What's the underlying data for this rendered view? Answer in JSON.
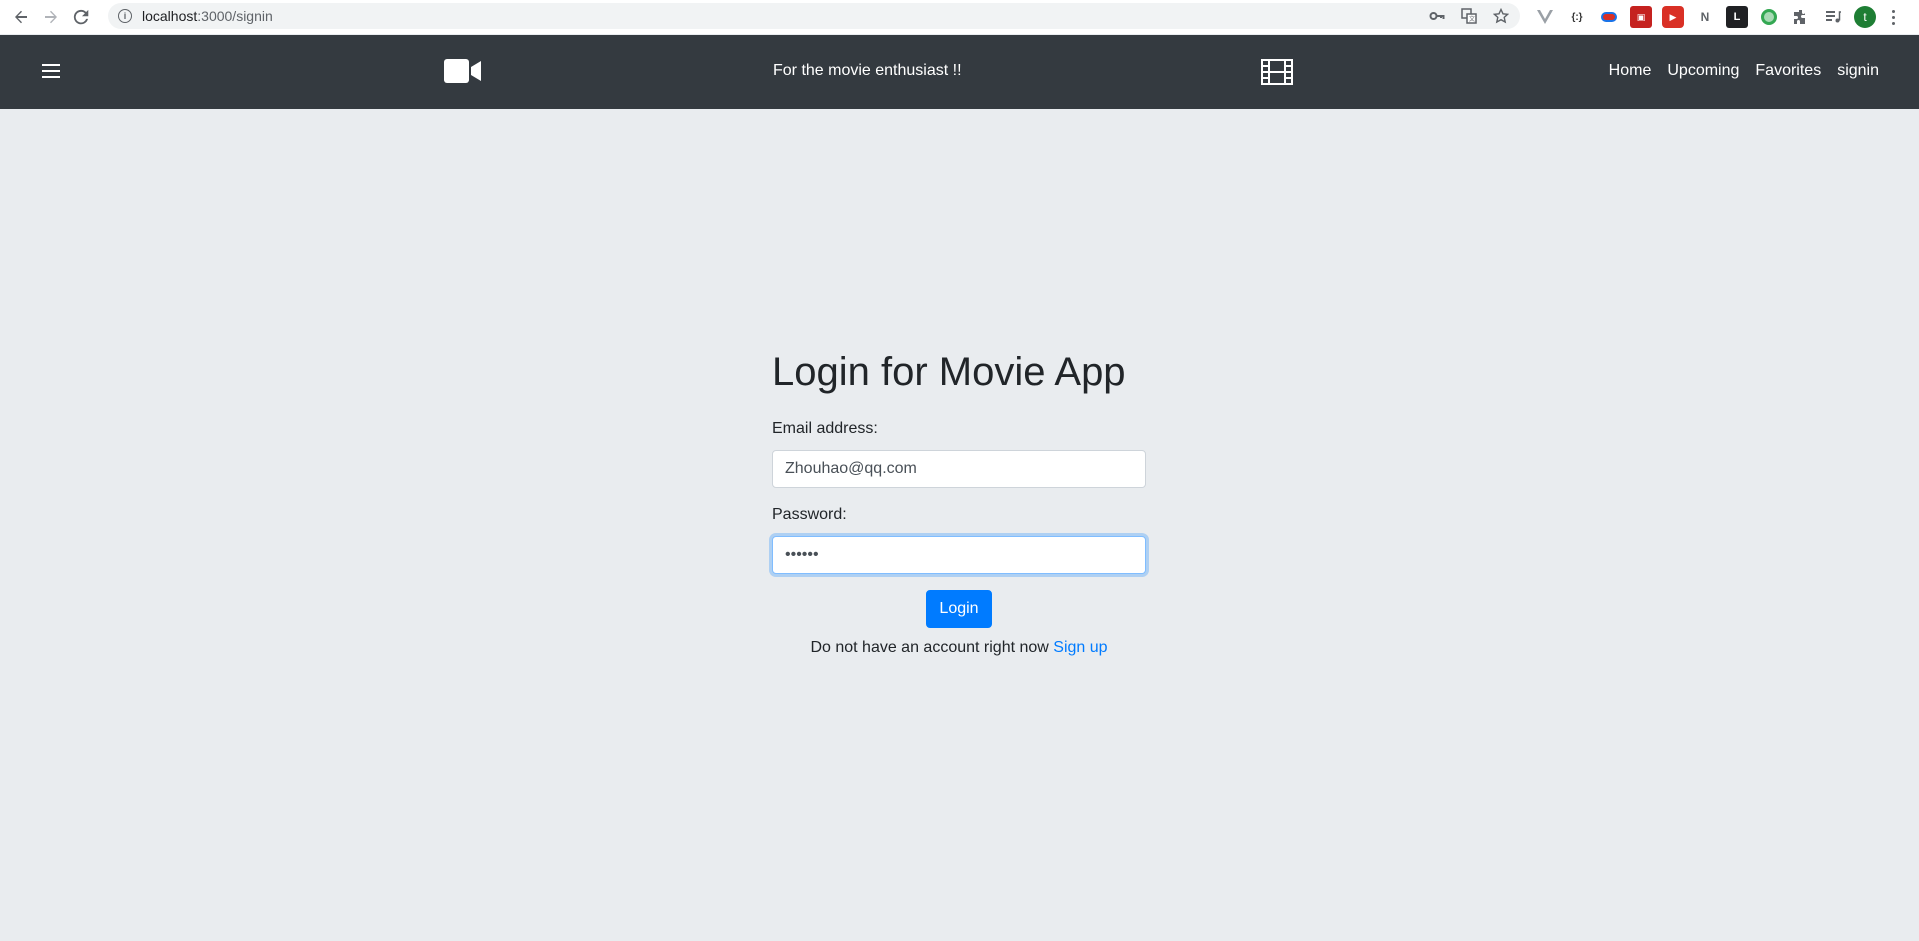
{
  "browser": {
    "url_host": "localhost",
    "url_path": ":3000/signin",
    "extensions": [
      "vue-devtools-icon",
      "json-icon",
      "ext-blue-icon",
      "ext-red-icon",
      "ext-play-icon",
      "ext-n-icon",
      "ext-l-icon",
      "ext-circle-icon",
      "puzzle-icon",
      "reading-list-icon"
    ],
    "profile_initial": "t"
  },
  "navbar": {
    "tagline": "For the movie enthusiast !!",
    "links": {
      "home": "Home",
      "upcoming": "Upcoming",
      "favorites": "Favorites",
      "signin": "signin"
    },
    "background": "#343a40"
  },
  "login": {
    "title": "Login for Movie App",
    "email_label": "Email address:",
    "email_value": "Zhouhao@qq.com",
    "password_label": "Password:",
    "password_value": "••••••",
    "login_button": "Login",
    "signup_prompt": "Do not have an account right now",
    "signup_link": "Sign up"
  },
  "colors": {
    "page_bg": "#e9ecef",
    "primary": "#007bff"
  }
}
